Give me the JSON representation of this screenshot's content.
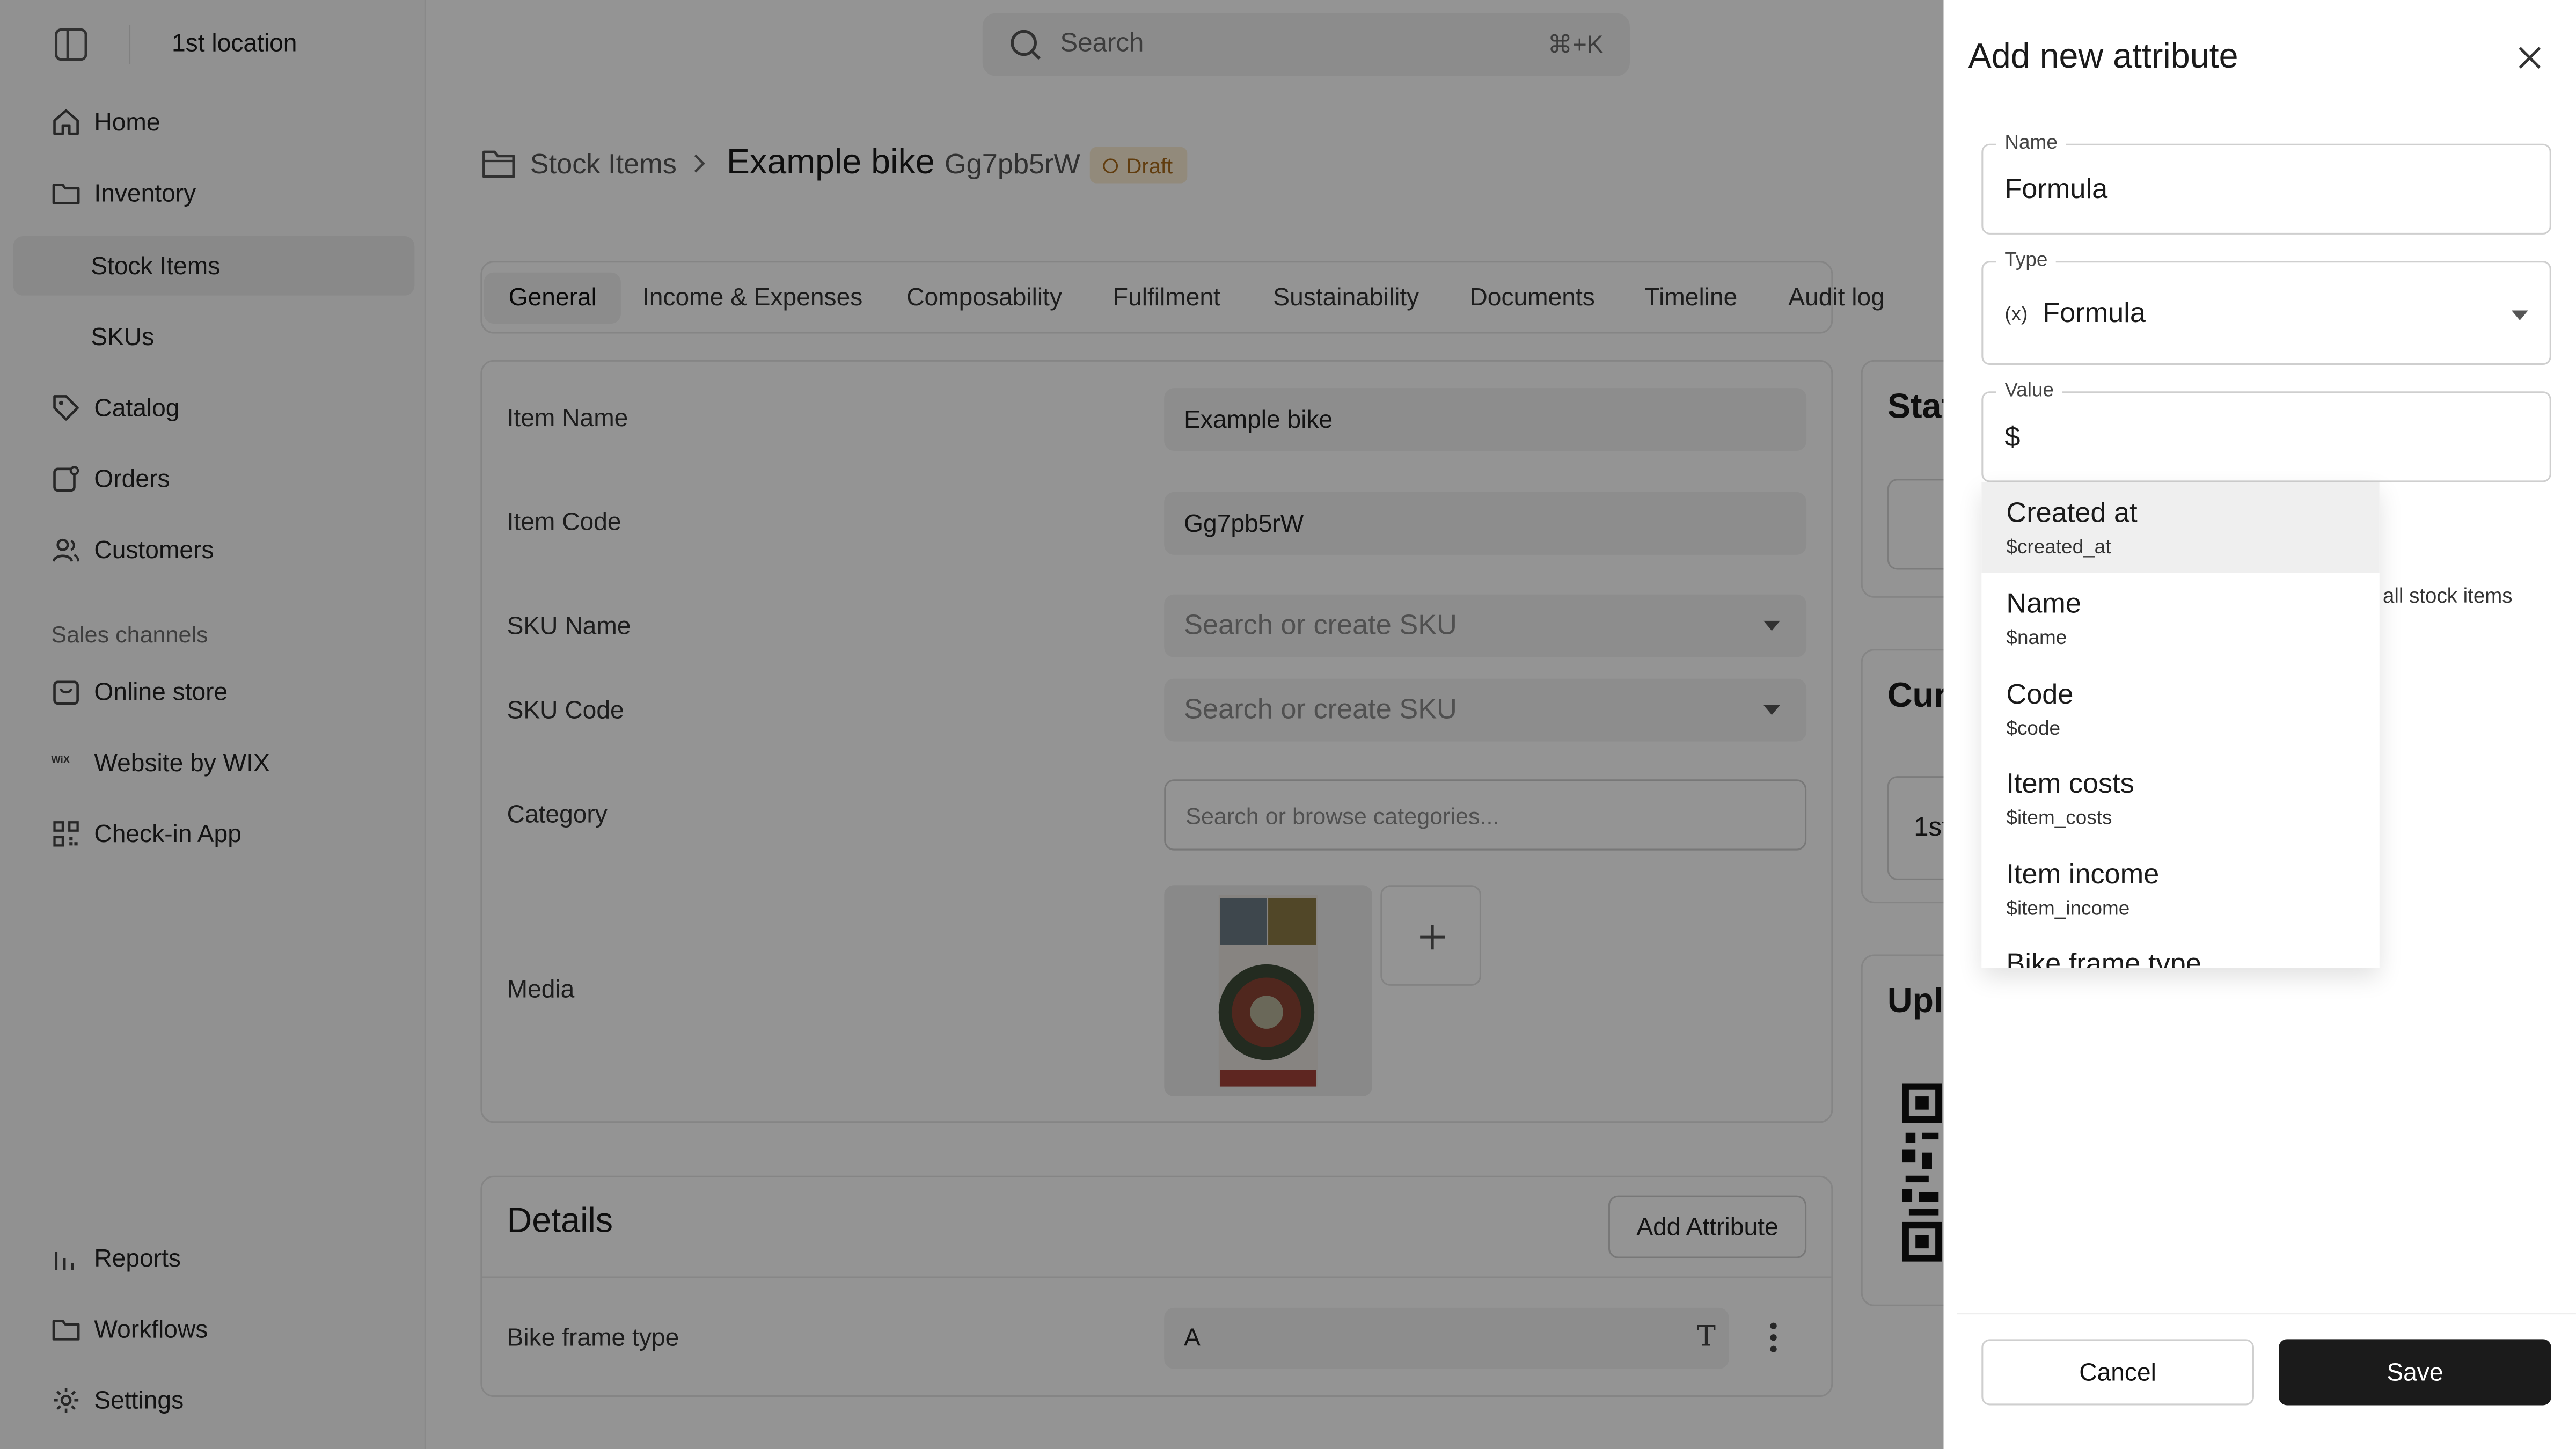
{
  "sidebar": {
    "location": "1st location",
    "nav": [
      {
        "label": "Home",
        "icon": "home-icon"
      },
      {
        "label": "Inventory",
        "icon": "folder-icon"
      },
      {
        "label": "Stock Items",
        "active": true
      },
      {
        "label": "SKUs"
      },
      {
        "label": "Catalog",
        "icon": "tag-icon"
      },
      {
        "label": "Orders",
        "icon": "orders-icon"
      },
      {
        "label": "Customers",
        "icon": "users-icon"
      }
    ],
    "sales_channels_heading": "Sales channels",
    "channels": [
      {
        "label": "Online store",
        "icon": "store-bag-icon"
      },
      {
        "label": "Website by WIX",
        "icon": "wix-logo-icon",
        "icon_text": "WiX"
      },
      {
        "label": "Check-in App",
        "icon": "qr-code-icon"
      }
    ],
    "bottom": [
      {
        "label": "Reports",
        "icon": "bar-chart-icon"
      },
      {
        "label": "Workflows",
        "icon": "folder-icon"
      },
      {
        "label": "Settings",
        "icon": "gear-icon"
      }
    ]
  },
  "search": {
    "placeholder": "Search",
    "shortcut": "⌘+K"
  },
  "breadcrumb": {
    "section": "Stock Items",
    "title": "Example bike",
    "code": "Gg7pb5rW",
    "status": "Draft"
  },
  "tabs": [
    "General",
    "Income & Expenses",
    "Composability",
    "Fulfilment",
    "Sustainability",
    "Documents",
    "Timeline",
    "Audit log"
  ],
  "form": {
    "item_name_label": "Item Name",
    "item_name_value": "Example bike",
    "item_code_label": "Item Code",
    "item_code_value": "Gg7pb5rW",
    "sku_name_label": "SKU Name",
    "sku_name_placeholder": "Search or create SKU",
    "sku_code_label": "SKU Code",
    "sku_code_placeholder": "Search or create SKU",
    "category_label": "Category",
    "category_placeholder": "Search or browse categories...",
    "media_label": "Media"
  },
  "details": {
    "title": "Details",
    "add_attribute": "Add Attribute",
    "attr_label": "Bike frame type",
    "attr_value": "A",
    "attr_type_glyph": "T"
  },
  "right_cards": {
    "status_title_fragment": "Stat",
    "current_title_fragment": "Cur",
    "current_value_fragment": "1st",
    "upload_title_fragment": "Upl"
  },
  "drawer": {
    "title": "Add new attribute",
    "name_legend": "Name",
    "name_value": "Formula",
    "type_legend": "Type",
    "type_prefix": "(x)",
    "type_value": "Formula",
    "value_legend": "Value",
    "value_value": "$",
    "options": [
      {
        "title": "Created at",
        "var": "$created_at",
        "highlighted": true
      },
      {
        "title": "Name",
        "var": "$name"
      },
      {
        "title": "Code",
        "var": "$code"
      },
      {
        "title": "Item costs",
        "var": "$item_costs"
      },
      {
        "title": "Item income",
        "var": "$item_income"
      },
      {
        "title": "Bike frame type",
        "var": ""
      }
    ],
    "helper_text": "all stock items",
    "cancel": "Cancel",
    "save": "Save"
  },
  "colors": {
    "badge_bg": "#fbeed4",
    "badge_text": "#a7691a",
    "primary_button": "#1b1b1b",
    "overlay": "rgba(0,0,0,0.42)"
  }
}
